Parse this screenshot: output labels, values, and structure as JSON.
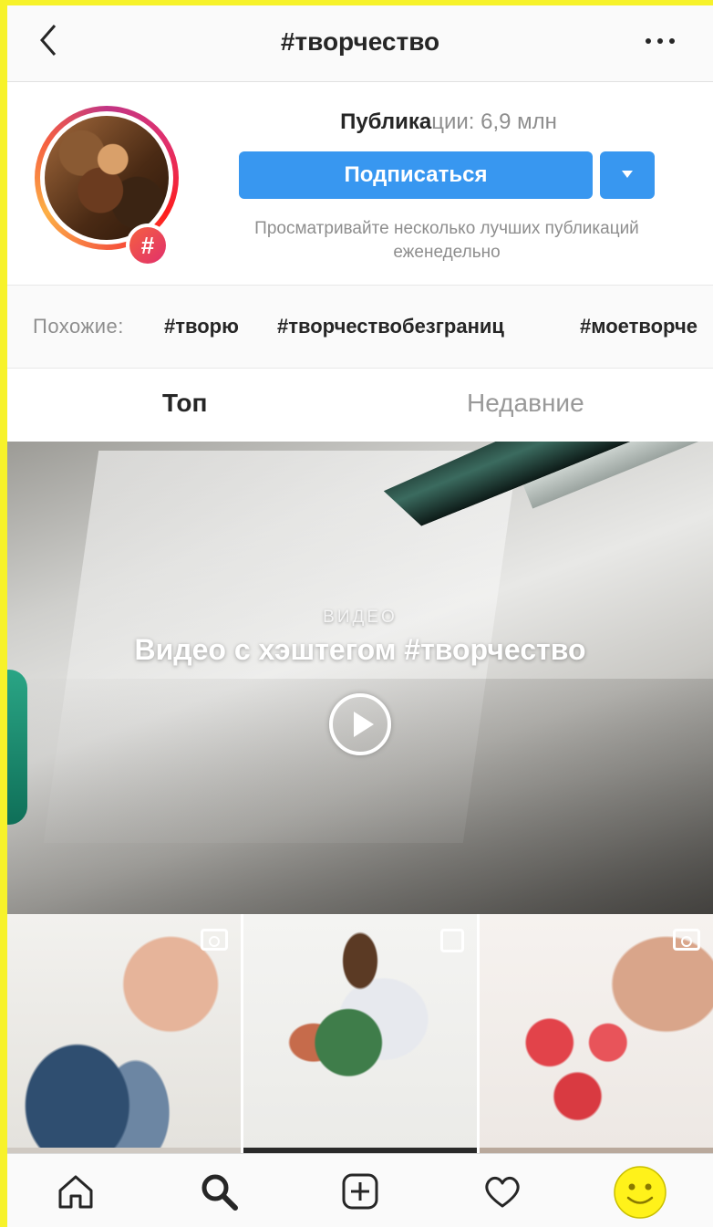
{
  "header": {
    "title": "#творчество",
    "back_icon": "chevron-left-icon",
    "more_icon": "more-horizontal-icon"
  },
  "hashtag": {
    "badge_symbol": "#",
    "posts_prefix": "Публика",
    "posts_suffix": "ции: 6,9 млн",
    "subscribe_label": "Подписаться",
    "hint": "Просматривайте несколько лучших публикаций еженедельно"
  },
  "related": {
    "label": "Похожие:",
    "tags": [
      "#творю",
      "#творчествобезграниц",
      "#моетворче"
    ]
  },
  "tabs": [
    {
      "label": "Топ",
      "active": true
    },
    {
      "label": "Недавние",
      "active": false
    }
  ],
  "featured_video": {
    "kicker": "ВИДЕО",
    "title": "Видео с хэштегом #творчество",
    "play_icon": "play-circle-icon"
  },
  "grid": [
    {
      "kind": "video",
      "badge_icon": "video-camera-icon"
    },
    {
      "kind": "carousel",
      "badge_icon": "multiple-photos-icon"
    },
    {
      "kind": "video",
      "badge_icon": "video-camera-icon"
    }
  ],
  "bottom_nav": [
    {
      "name": "home",
      "icon": "home-icon"
    },
    {
      "name": "search",
      "icon": "search-icon",
      "active": true
    },
    {
      "name": "add",
      "icon": "add-post-icon"
    },
    {
      "name": "activity",
      "icon": "heart-icon"
    },
    {
      "name": "profile",
      "icon": "smiley-avatar-icon"
    }
  ],
  "colors": {
    "accent": "#3897f0",
    "frame": "#f7f22a",
    "smiley": "#fff21a"
  }
}
